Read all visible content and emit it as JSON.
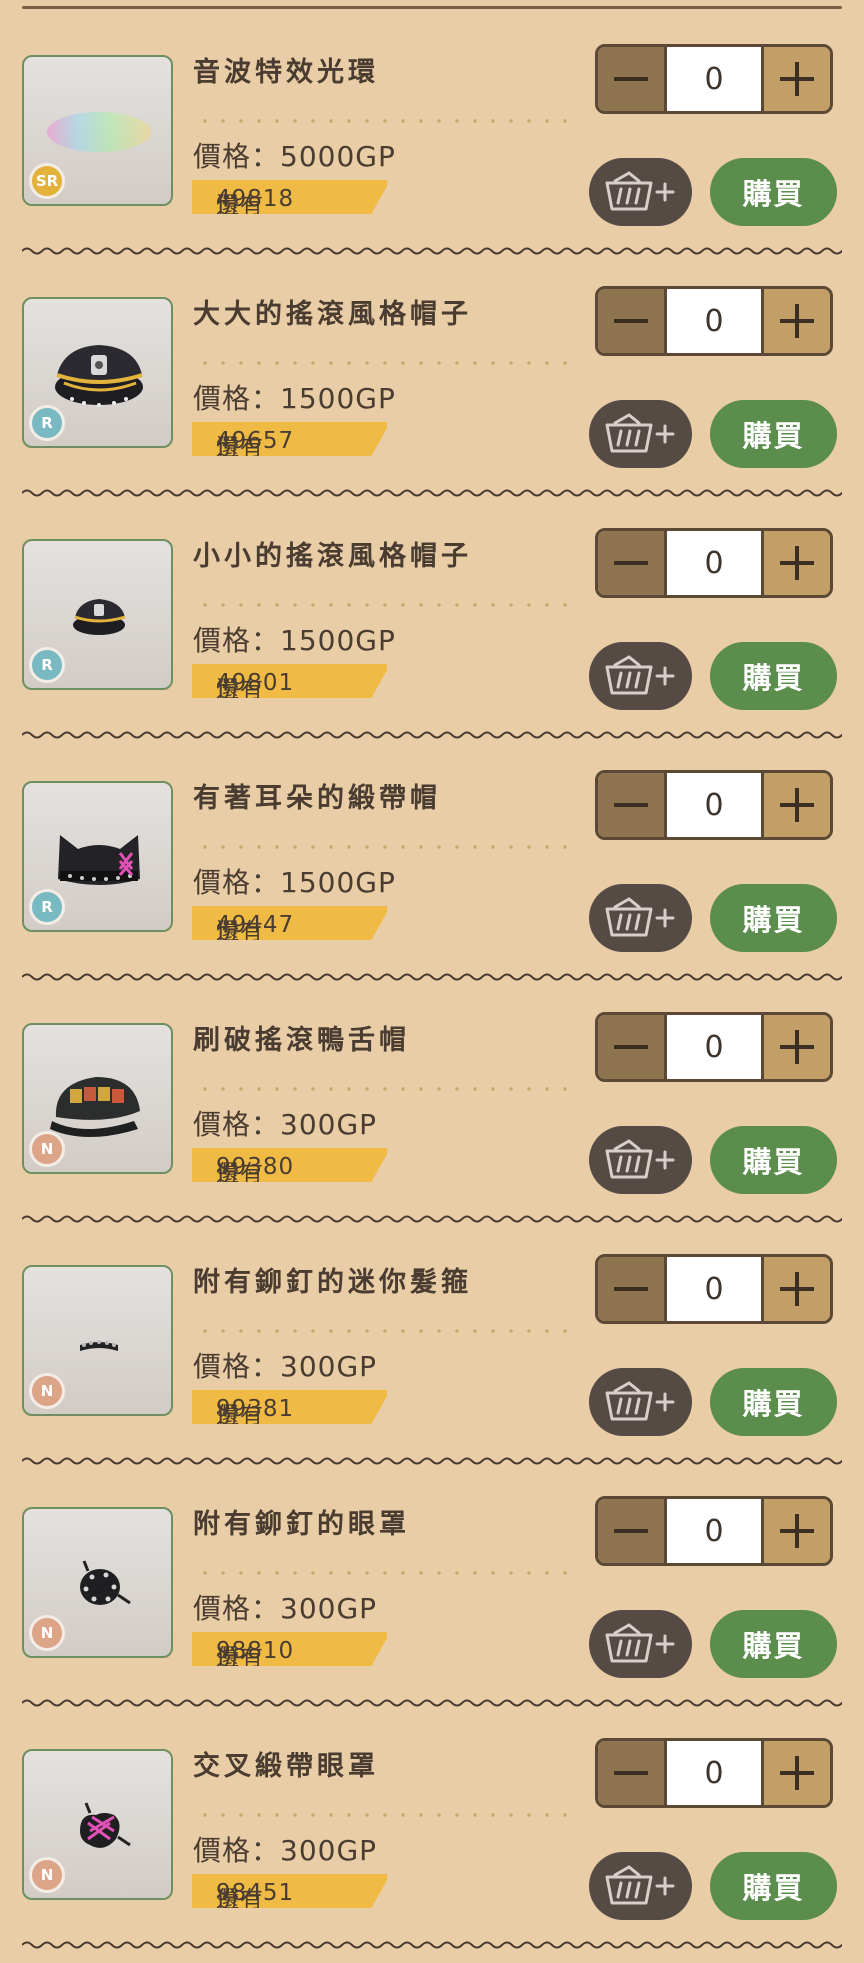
{
  "labels": {
    "price_prefix": "價格：",
    "stock_prefix": "還有 ",
    "stock_suffix": "份",
    "buy": "購買"
  },
  "items": [
    {
      "name": "音波特效光環",
      "price": "5000GP",
      "stock": "49818",
      "rarity": "SR",
      "rarity_color": "#e2b23a",
      "qty": "0",
      "art": "soundwave-halo"
    },
    {
      "name": "大大的搖滾風格帽子",
      "price": "1500GP",
      "stock": "49657",
      "rarity": "R",
      "rarity_color": "#79b9c2",
      "qty": "0",
      "art": "big-rock-cap"
    },
    {
      "name": "小小的搖滾風格帽子",
      "price": "1500GP",
      "stock": "49801",
      "rarity": "R",
      "rarity_color": "#79b9c2",
      "qty": "0",
      "art": "small-rock-cap"
    },
    {
      "name": "有著耳朵的緞帶帽",
      "price": "1500GP",
      "stock": "49447",
      "rarity": "R",
      "rarity_color": "#79b9c2",
      "qty": "0",
      "art": "eared-ribbon-hat"
    },
    {
      "name": "刷破搖滾鴨舌帽",
      "price": "300GP",
      "stock": "99380",
      "rarity": "N",
      "rarity_color": "#dca588",
      "qty": "0",
      "art": "ripped-rock-cap"
    },
    {
      "name": "附有鉚釘的迷你髮箍",
      "price": "300GP",
      "stock": "99381",
      "rarity": "N",
      "rarity_color": "#dca588",
      "qty": "0",
      "art": "studded-mini-headband"
    },
    {
      "name": "附有鉚釘的眼罩",
      "price": "300GP",
      "stock": "98810",
      "rarity": "N",
      "rarity_color": "#dca588",
      "qty": "0",
      "art": "studded-eyepatch"
    },
    {
      "name": "交叉緞帶眼罩",
      "price": "300GP",
      "stock": "98451",
      "rarity": "N",
      "rarity_color": "#dca588",
      "qty": "0",
      "art": "cross-ribbon-eyepatch"
    }
  ]
}
